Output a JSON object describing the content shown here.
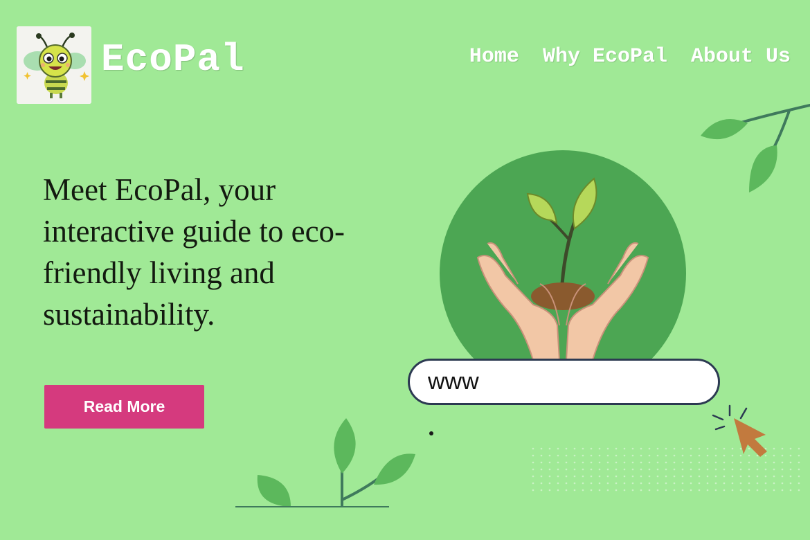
{
  "header": {
    "brand": "EcoPal",
    "logo_icon": "bee-mascot-icon",
    "nav": [
      {
        "label": "Home"
      },
      {
        "label": "Why EcoPal"
      },
      {
        "label": "About Us"
      }
    ]
  },
  "hero": {
    "headline": "Meet EcoPal, your interactive guide to eco-friendly living and sustainability.",
    "button_label": "Read More"
  },
  "search": {
    "value": "www",
    "icon": "search-icon"
  },
  "colors": {
    "background": "#a0e996",
    "button": "#d53a7e",
    "circle": "#4ca653",
    "text": "#131a10"
  }
}
